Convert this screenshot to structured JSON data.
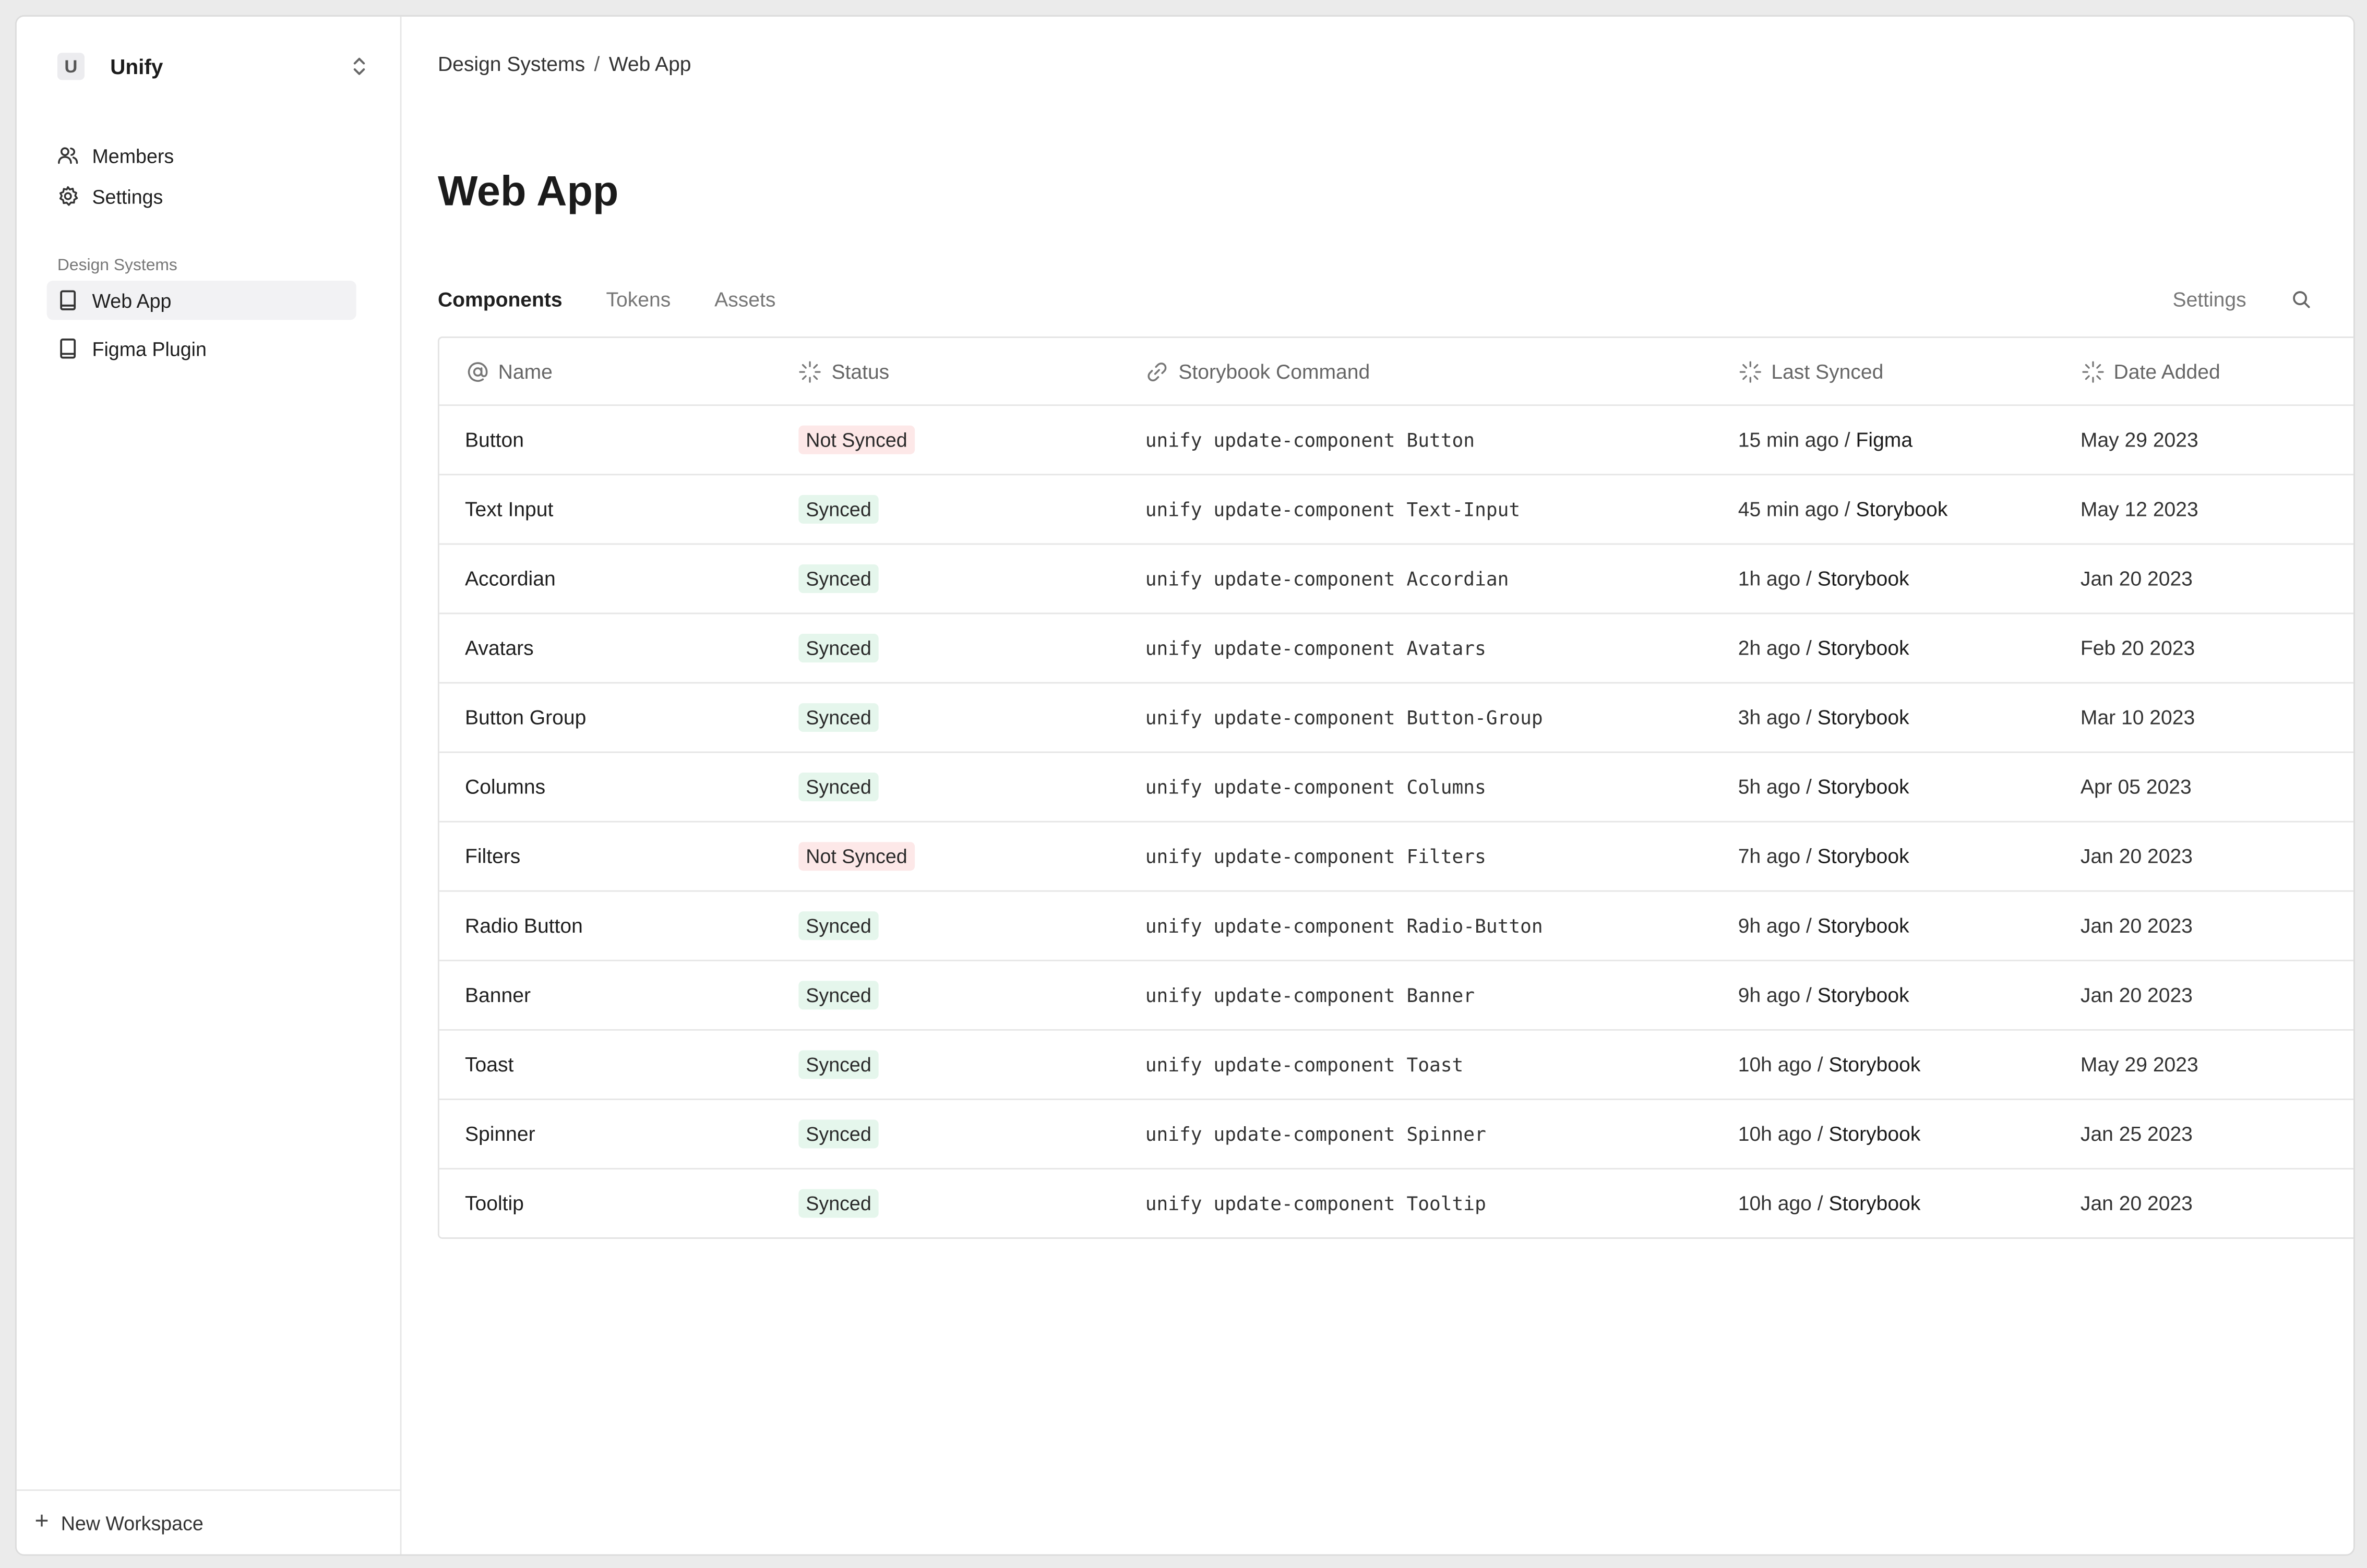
{
  "workspace": {
    "initial": "U",
    "name": "Unify"
  },
  "nav": {
    "members": "Members",
    "settings": "Settings",
    "section_label": "Design Systems",
    "systems": [
      "Web App",
      "Figma Plugin"
    ],
    "new_workspace": "New Workspace"
  },
  "breadcrumb": {
    "parent": "Design Systems",
    "sep": "/",
    "current": "Web App"
  },
  "page": {
    "title": "Web App"
  },
  "tabs": [
    "Components",
    "Tokens",
    "Assets"
  ],
  "tab_right": {
    "settings": "Settings"
  },
  "columns": {
    "name": "Name",
    "status": "Status",
    "command": "Storybook Command",
    "last_synced": "Last Synced",
    "date_added": "Date Added"
  },
  "rows": [
    {
      "name": "Button",
      "status": "Not Synced",
      "command": "unify update-component Button",
      "last_time": "15 min ago /",
      "last_src": "Figma",
      "date": "May 29 2023"
    },
    {
      "name": "Text Input",
      "status": "Synced",
      "command": "unify update-component Text-Input",
      "last_time": "45 min ago /",
      "last_src": "Storybook",
      "date": "May 12 2023"
    },
    {
      "name": "Accordian",
      "status": "Synced",
      "command": "unify update-component Accordian",
      "last_time": "1h ago /",
      "last_src": "Storybook",
      "date": "Jan 20 2023"
    },
    {
      "name": "Avatars",
      "status": "Synced",
      "command": "unify update-component Avatars",
      "last_time": "2h ago /",
      "last_src": "Storybook",
      "date": "Feb 20 2023"
    },
    {
      "name": "Button Group",
      "status": "Synced",
      "command": "unify update-component Button-Group",
      "last_time": "3h ago /",
      "last_src": "Storybook",
      "date": "Mar 10 2023"
    },
    {
      "name": "Columns",
      "status": "Synced",
      "command": "unify update-component Columns",
      "last_time": "5h ago /",
      "last_src": "Storybook",
      "date": "Apr 05 2023"
    },
    {
      "name": "Filters",
      "status": "Not Synced",
      "command": "unify update-component Filters",
      "last_time": "7h ago /",
      "last_src": "Storybook",
      "date": "Jan 20 2023"
    },
    {
      "name": "Radio Button",
      "status": "Synced",
      "command": "unify update-component Radio-Button",
      "last_time": "9h ago /",
      "last_src": "Storybook",
      "date": "Jan 20 2023"
    },
    {
      "name": "Banner",
      "status": "Synced",
      "command": "unify update-component Banner",
      "last_time": "9h ago /",
      "last_src": "Storybook",
      "date": "Jan 20 2023"
    },
    {
      "name": "Toast",
      "status": "Synced",
      "command": "unify update-component Toast",
      "last_time": "10h ago /",
      "last_src": "Storybook",
      "date": "May 29 2023"
    },
    {
      "name": "Spinner",
      "status": "Synced",
      "command": "unify update-component Spinner",
      "last_time": "10h ago /",
      "last_src": "Storybook",
      "date": "Jan 25 2023"
    },
    {
      "name": "Tooltip",
      "status": "Synced",
      "command": "unify update-component Tooltip",
      "last_time": "10h ago /",
      "last_src": "Storybook",
      "date": "Jan 20 2023"
    }
  ],
  "colors": {
    "not_synced_bg": "#fde8e8",
    "synced_bg": "#e5f6ec",
    "active_nav_bg": "#f2f2f4"
  },
  "icons": {
    "workspace_toggle": "chevron-up-down-icon",
    "members": "users-icon",
    "settings": "gear-icon",
    "design_system": "book-icon",
    "search": "search-icon",
    "col_name": "at-sign-icon",
    "col_status": "loader-icon",
    "col_command": "link-icon",
    "col_last": "loader-icon",
    "col_date": "loader-icon",
    "add": "plus-icon"
  }
}
